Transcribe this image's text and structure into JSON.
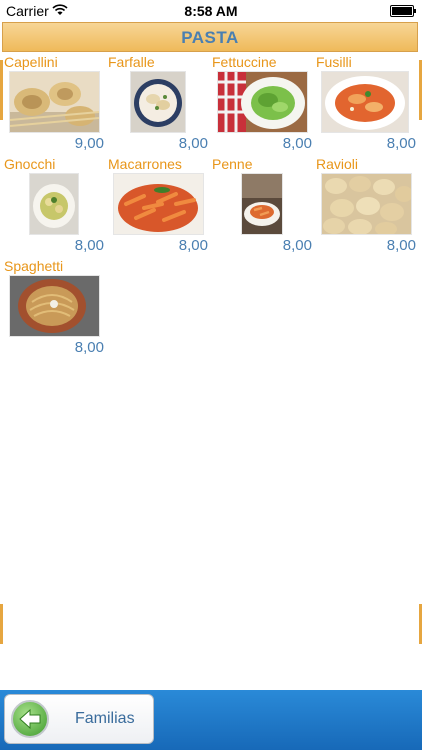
{
  "status_bar": {
    "carrier": "Carrier",
    "time": "8:58 AM"
  },
  "title": "PASTA",
  "items": [
    {
      "name": "Capellini",
      "price": "9,00"
    },
    {
      "name": "Farfalle",
      "price": "8,00"
    },
    {
      "name": "Fettuccine",
      "price": "8,00"
    },
    {
      "name": "Fusilli",
      "price": "8,00"
    },
    {
      "name": "Gnocchi",
      "price": "8,00"
    },
    {
      "name": "Macarrones",
      "price": "8,00"
    },
    {
      "name": "Penne",
      "price": "8,00"
    },
    {
      "name": "Ravioli",
      "price": "8,00"
    },
    {
      "name": "Spaghetti",
      "price": "8,00"
    }
  ],
  "bottom_bar": {
    "back_label": "Familias"
  },
  "colors": {
    "accent_orange": "#e8961a",
    "price_blue": "#4a7fb1",
    "bottom_blue": "#1f78c8"
  }
}
